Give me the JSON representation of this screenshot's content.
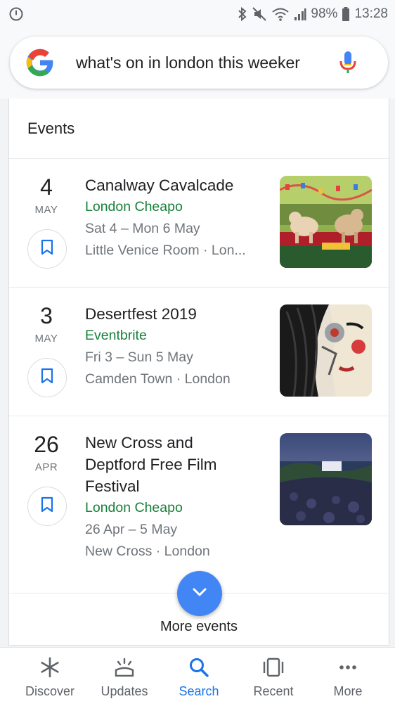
{
  "status_bar": {
    "battery": "98%",
    "time": "13:28"
  },
  "search": {
    "query": "what's on in london this weeker"
  },
  "events_card": {
    "header": "Events",
    "events": [
      {
        "day": "4",
        "month": "MAY",
        "title_lines": [
          "Canalway Cavalcade"
        ],
        "source": "London Cheapo",
        "dates": "Sat 4 – Mon 6 May",
        "location": "Little Venice Room · Lon..."
      },
      {
        "day": "3",
        "month": "MAY",
        "title_lines": [
          "Desertfest 2019"
        ],
        "source": "Eventbrite",
        "dates": "Fri 3 – Sun 5 May",
        "location": "Camden Town · London"
      },
      {
        "day": "26",
        "month": "APR",
        "title_lines": [
          "New Cross and",
          "Deptford Free Film",
          "Festival"
        ],
        "source": "London Cheapo",
        "dates": "26 Apr – 5 May",
        "location": "New Cross · London"
      }
    ],
    "more_label": "More events"
  },
  "bottom_nav": {
    "items": [
      {
        "label": "Discover",
        "icon": "asterisk-icon"
      },
      {
        "label": "Updates",
        "icon": "updates-icon"
      },
      {
        "label": "Search",
        "icon": "search-icon"
      },
      {
        "label": "Recent",
        "icon": "recent-icon"
      },
      {
        "label": "More",
        "icon": "more-dots-icon"
      }
    ]
  },
  "colors": {
    "link_green": "#188038",
    "accent_blue": "#1a73e8",
    "fab_blue": "#4285f4"
  }
}
